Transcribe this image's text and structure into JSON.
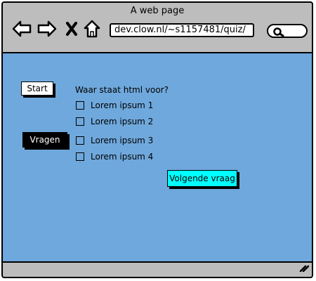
{
  "window": {
    "title": "A web page",
    "url": "dev.clow.nl/~s1157481/quiz/"
  },
  "toolbar": {
    "icons": [
      "back-arrow-icon",
      "forward-arrow-icon",
      "close-icon",
      "home-icon",
      "search-icon"
    ]
  },
  "sidebar": {
    "start_label": "Start",
    "vragen_label": "Vragen"
  },
  "quiz": {
    "question": "Waar staat html voor?",
    "answers": [
      {
        "label": "Lorem ipsum 1",
        "checked": false
      },
      {
        "label": "Lorem ipsum 2",
        "checked": false
      },
      {
        "label": "Lorem ipsum 3",
        "checked": false
      },
      {
        "label": "Lorem ipsum 4",
        "checked": false
      }
    ],
    "next_label": "Volgende vraag"
  },
  "colors": {
    "content_background": "#6fa8dc",
    "chrome": "#bdbdbd",
    "next_button": "#00ffff",
    "vragen_button": "#000000"
  }
}
